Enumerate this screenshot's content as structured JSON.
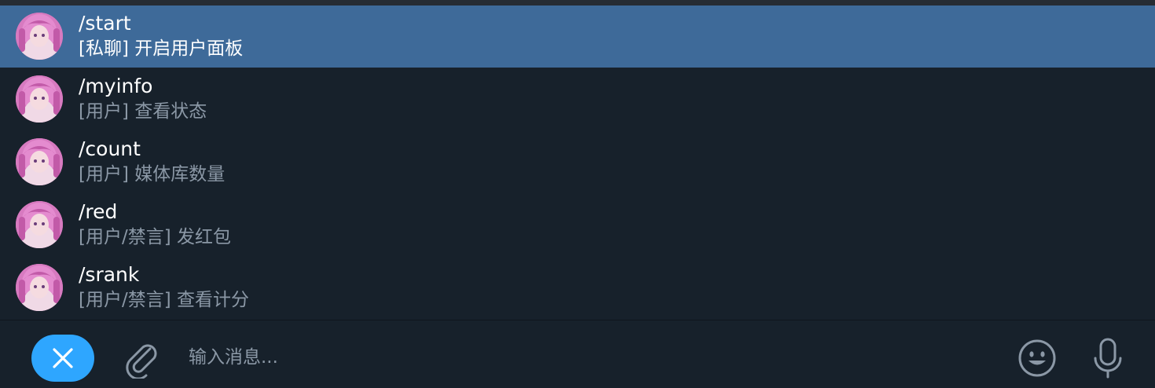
{
  "colors": {
    "background": "#17212b",
    "selected_row": "#3e6a99",
    "accent": "#2ea6ff",
    "secondary_text": "#8b98a6",
    "icon": "#8b98a6"
  },
  "commands": [
    {
      "name": "/start",
      "description": "[私聊] 开启用户面板",
      "selected": true
    },
    {
      "name": "/myinfo",
      "description": "[用户] 查看状态"
    },
    {
      "name": "/count",
      "description": "[用户] 媒体库数量"
    },
    {
      "name": "/red",
      "description": "[用户/禁言] 发红包"
    },
    {
      "name": "/srank",
      "description": "[用户/禁言] 查看计分"
    }
  ],
  "input_bar": {
    "placeholder": "输入消息...",
    "value": "",
    "icons": {
      "close": "close-icon",
      "attach": "paperclip-icon",
      "emoji": "emoji-smile-icon",
      "voice": "microphone-icon"
    }
  }
}
